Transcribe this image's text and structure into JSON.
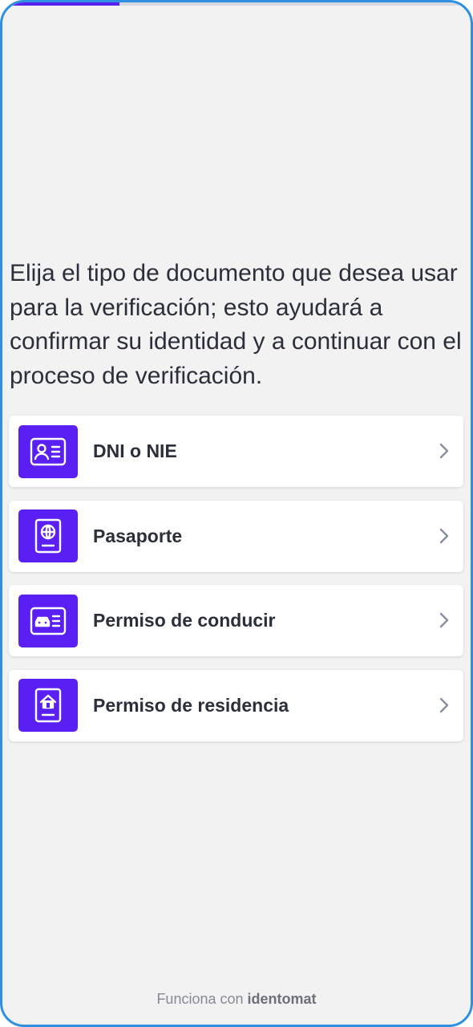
{
  "progress": {
    "fraction": 0.25,
    "fill_color": "#5a22f0"
  },
  "intro_text": "Elija el tipo de documento que desea usar para la verificación; esto ayudará a confirmar su identidad y a continuar con el proceso de verificación.",
  "documents": [
    {
      "label": "DNI o NIE",
      "icon": "id-card-icon"
    },
    {
      "label": "Pasaporte",
      "icon": "passport-icon"
    },
    {
      "label": "Permiso de conducir",
      "icon": "driving-license-icon"
    },
    {
      "label": "Permiso de residencia",
      "icon": "residence-permit-icon"
    }
  ],
  "footer": {
    "prefix": "Funciona con",
    "brand": "identomat"
  },
  "colors": {
    "accent": "#5a1ff2",
    "background": "#f2f2f3",
    "frame_border": "#2f8fe0"
  }
}
